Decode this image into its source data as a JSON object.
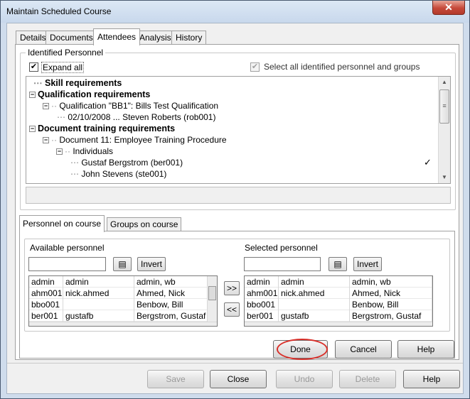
{
  "window": {
    "title": "Maintain Scheduled Course",
    "close_glyph": "✕"
  },
  "tabs": [
    "Details",
    "Documents",
    "Attendees",
    "Analysis",
    "History"
  ],
  "identified": {
    "group_label": "Identified Personnel",
    "expand_all_label": "Expand all",
    "expand_all_checked": true,
    "select_all_label": "Select all identified personnel and groups",
    "select_all_checked": true
  },
  "tree": {
    "rows": [
      {
        "text": "Skill requirements",
        "bold": true
      },
      {
        "text": "Qualification requirements",
        "bold": true
      },
      {
        "text": "Qualification \"BB1\": Bills Test Qualification"
      },
      {
        "text": "02/10/2008 ... Steven Roberts (rob001)"
      },
      {
        "text": "Document training requirements",
        "bold": true
      },
      {
        "text": "Document 11: Employee Training Procedure"
      },
      {
        "text": "Individuals"
      },
      {
        "text": "Gustaf Bergstrom (ber001)",
        "mark": "✓"
      },
      {
        "text": "John Stevens (ste001)"
      }
    ]
  },
  "subtabs": [
    "Personnel on course",
    "Groups on course"
  ],
  "available": {
    "label": "Available personnel",
    "search_value": "",
    "invert_label": "Invert",
    "rows": [
      [
        "admin",
        "admin",
        "admin, wb"
      ],
      [
        "ahm001",
        "nick.ahmed",
        "Ahmed, Nick"
      ],
      [
        "bbo001",
        "",
        "Benbow, Bill"
      ],
      [
        "ber001",
        "gustafb",
        "Bergstrom, Gustaf"
      ]
    ]
  },
  "selected": {
    "label": "Selected personnel",
    "search_value": "",
    "invert_label": "Invert",
    "rows": [
      [
        "admin",
        "admin",
        "admin, wb"
      ],
      [
        "ahm001",
        "nick.ahmed",
        "Ahmed, Nick"
      ],
      [
        "bbo001",
        "",
        "Benbow, Bill"
      ],
      [
        "ber001",
        "gustafb",
        "Bergstrom, Gustaf"
      ]
    ]
  },
  "move": {
    "add": ">>",
    "remove": "<<"
  },
  "dialog_buttons": {
    "done": "Done",
    "cancel": "Cancel",
    "help": "Help"
  },
  "footer_buttons": {
    "save": "Save",
    "close": "Close",
    "undo": "Undo",
    "delete": "Delete",
    "help": "Help"
  },
  "colors": {
    "highlight_ring": "#d9302a",
    "window_frame": "#cfdcec"
  },
  "icons": {
    "search": "search-list-icon",
    "check": "check-mark-icon"
  }
}
